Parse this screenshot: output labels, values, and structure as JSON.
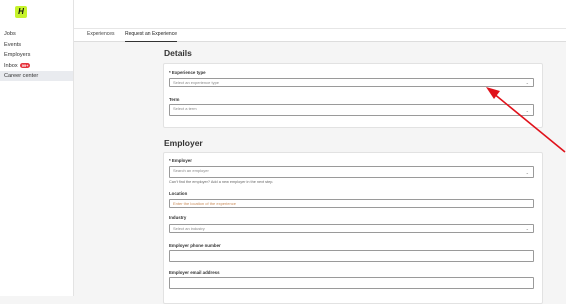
{
  "logo": {
    "text": "H"
  },
  "sidebar": {
    "items": [
      {
        "label": "Jobs"
      },
      {
        "label": "Events"
      },
      {
        "label": "Employers"
      },
      {
        "label": "Inbox",
        "badge": "99+"
      },
      {
        "label": "Career center"
      }
    ]
  },
  "tabs": [
    {
      "label": "Experiences"
    },
    {
      "label": "Request an Experience"
    }
  ],
  "details": {
    "heading": "Details",
    "experience_type": {
      "label": "* Experience type",
      "placeholder": "Select an experience type"
    },
    "term": {
      "label": "Term",
      "placeholder": "Select a term"
    }
  },
  "employer": {
    "heading": "Employer",
    "employer_field": {
      "label": "* Employer",
      "placeholder": "Search an employer",
      "helper": "Can't find the employer? Add a new employer in the next step."
    },
    "location": {
      "label": "Location",
      "placeholder": "Enter the location of the experience"
    },
    "industry": {
      "label": "Industry",
      "placeholder": "Select an industry"
    },
    "phone": {
      "label": "Employer phone number"
    },
    "email": {
      "label": "Employer email address"
    }
  },
  "colors": {
    "accent_logo": "#c6f32c",
    "badge": "#e5323b",
    "arrow": "#e0121b"
  }
}
